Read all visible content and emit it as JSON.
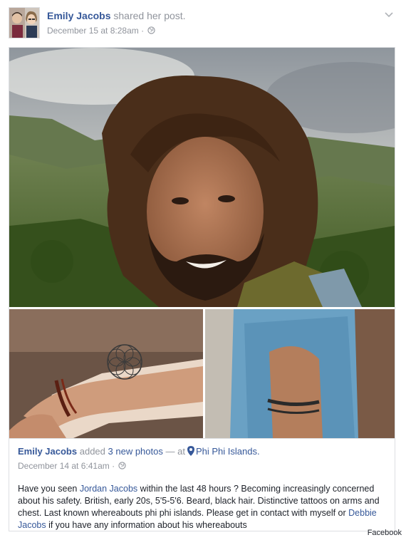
{
  "header": {
    "author": "Emily Jacobs",
    "action": "shared her post.",
    "timestamp": "December 15 at 8:28am",
    "separator": "·"
  },
  "inner_post": {
    "author": "Emily Jacobs",
    "action_prefix": "added",
    "photo_count_label": "3 new photos",
    "dash": "—",
    "at_label": "at",
    "location": "Phi Phi Islands.",
    "timestamp": "December 14 at 6:41am",
    "separator": "·",
    "text_part1": "Have you seen ",
    "mention1": "Jordan Jacobs",
    "text_part2": " within the last 48 hours ? Becoming increasingly concerned about his safety. British, early 20s, 5'5-5'6. Beard, black hair. Distinctive tattoos on arms and chest. Last known whereabouts phi phi islands. Please get in contact with myself or ",
    "mention2": "Debbie Jacobs",
    "text_part3": " if you have any information about his whereabouts"
  },
  "credit": "Facebook",
  "icons": {
    "audience": "globe-icon",
    "options": "chevron-down-icon",
    "location": "map-pin-icon"
  },
  "colors": {
    "link": "#365899",
    "meta": "#90949c",
    "text": "#1d2129",
    "border": "#dddfe2"
  }
}
